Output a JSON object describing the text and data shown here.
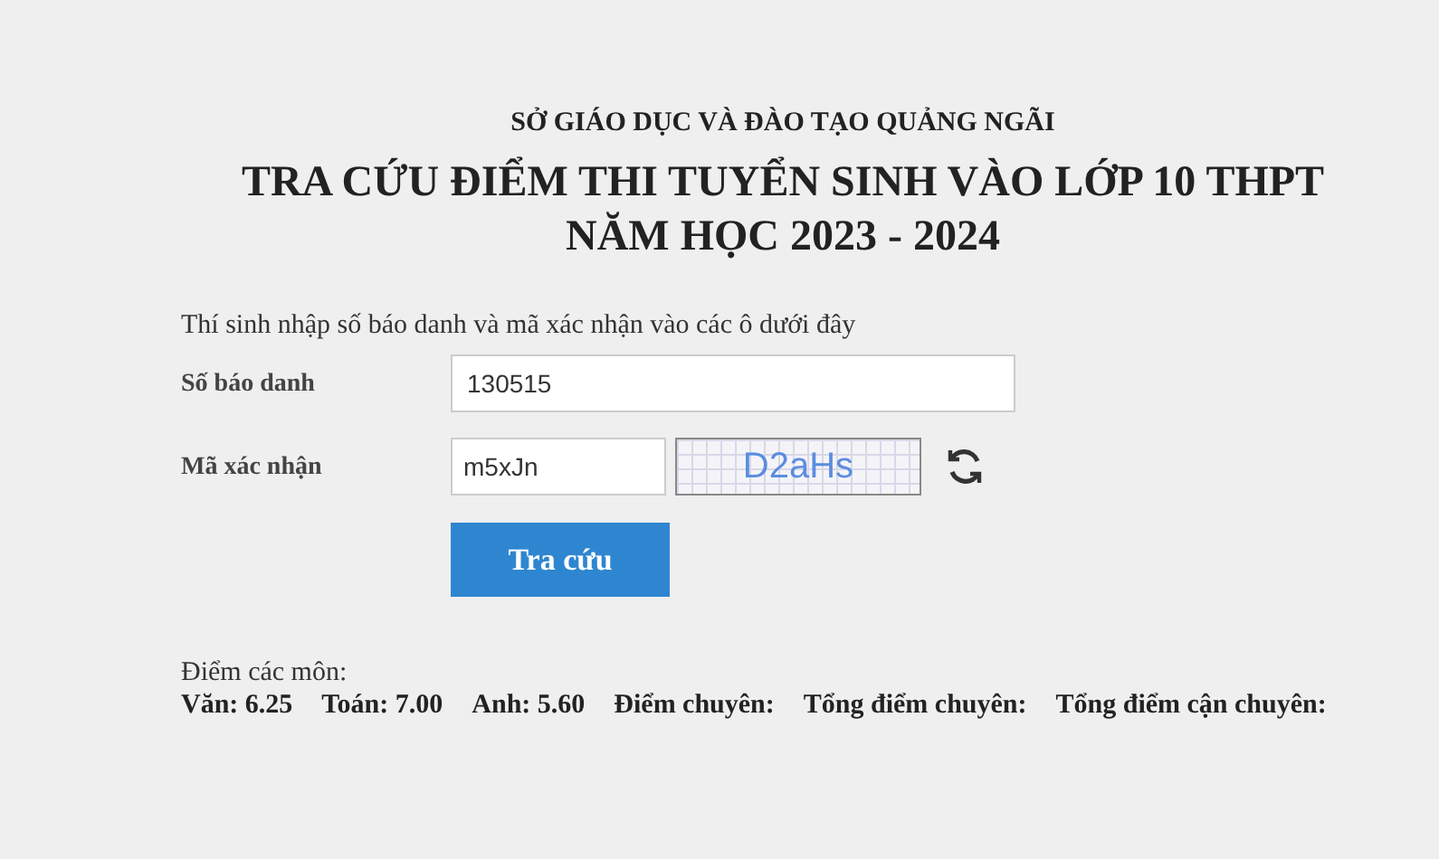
{
  "header": {
    "department": "SỞ GIÁO DỤC VÀ ĐÀO TẠO QUẢNG NGÃI",
    "title_lines": [
      "TRA CỨU ĐIỂM THI TUYỂN SINH VÀO LỚP 10 THPT",
      "NĂM HỌC 2023 - 2024"
    ]
  },
  "form": {
    "instruction": "Thí sinh nhập số báo danh và mã xác nhận vào các ô dưới đây",
    "candidate_number": {
      "label": "Số báo danh",
      "value": "130515"
    },
    "captcha": {
      "label": "Mã xác nhận",
      "value": "m5xJn",
      "image_text": "D2aHs"
    },
    "submit_button": "Tra cứu"
  },
  "results": {
    "heading": "Điểm các môn:",
    "scores": [
      "Văn: 6.25",
      "Toán: 7.00",
      "Anh: 5.60",
      "Điểm chuyên:",
      "Tổng điểm chuyên:",
      "Tổng điểm cận chuyên:"
    ]
  }
}
